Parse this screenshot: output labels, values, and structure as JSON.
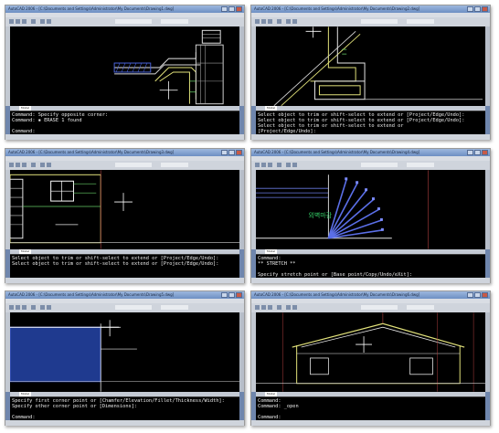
{
  "panels": [
    {
      "title": "AutoCAD 2006 - [C:\\Documents and Settings\\Administrator\\My Documents\\Drawing1.dwg]",
      "tab_model": "Model",
      "cmd": [
        "Command: Specify opposite corner:",
        "Command: ▪ ERASE 1 found",
        "",
        "Command:"
      ]
    },
    {
      "title": "AutoCAD 2006 - [C:\\Documents and Settings\\Administrator\\My Documents\\Drawing2.dwg]",
      "tab_model": "Model",
      "cmd": [
        "Select object to trim or shift-select to extend or [Project/Edge/Undo]:",
        "Select object to trim or shift-select to extend or [Project/Edge/Undo]:",
        "Select object to trim or shift-select to extend or",
        "[Project/Edge/Undo]:"
      ]
    },
    {
      "title": "AutoCAD 2006 - [C:\\Documents and Settings\\Administrator\\My Documents\\Drawing3.dwg]",
      "tab_model": "Model",
      "cmd": [
        "Select object to trim or shift-select to extend or [Project/Edge/Undo]:",
        "Select object to trim or shift-select to extend or [Project/Edge/Undo]:",
        "",
        ""
      ]
    },
    {
      "title": "AutoCAD 2006 - [C:\\Documents and Settings\\Administrator\\My Documents\\Drawing4.dwg]",
      "tab_model": "Model",
      "cmd": [
        "Command:",
        "** STRETCH **",
        "",
        "Specify stretch point or [Base point/Copy/Undo/eXit]:"
      ]
    },
    {
      "title": "AutoCAD 2006 - [C:\\Documents and Settings\\Administrator\\My Documents\\Drawing5.dwg]",
      "tab_model": "Model",
      "cmd": [
        "Specify first corner point or [Chamfer/Elevation/Fillet/Thickness/Width]:",
        "Specify other corner point or [Dimensions]:",
        "",
        "Command:"
      ]
    },
    {
      "title": "AutoCAD 2006 - [C:\\Documents and Settings\\Administrator\\My Documents\\Drawing6.dwg]",
      "tab_model": "Model",
      "cmd": [
        "Command:",
        "Command: _open",
        "",
        "Command:"
      ]
    }
  ],
  "menu_items": [
    "File",
    "Edit",
    "View",
    "Insert",
    "Format",
    "Tools",
    "Draw",
    "Dimension",
    "Modify",
    "Window",
    "Help"
  ],
  "annotation_text": "외벽마감"
}
